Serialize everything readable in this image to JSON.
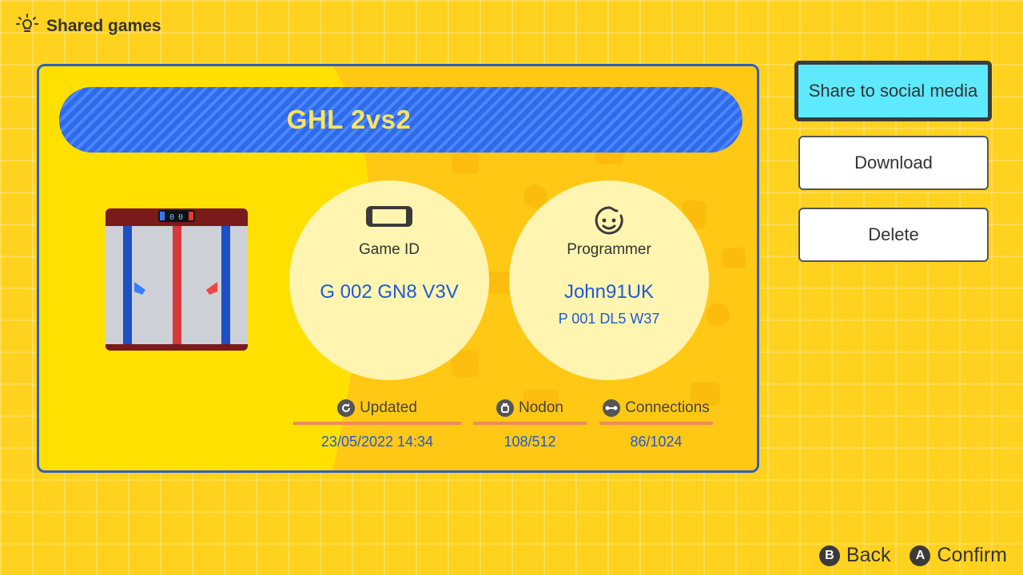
{
  "header": {
    "title": "Shared games",
    "icon": "lightbulb-icon"
  },
  "game": {
    "title": "GHL 2vs2",
    "thumbnail": {
      "score_left": "0",
      "score_right": "0"
    },
    "game_id": {
      "label": "Game ID",
      "value": "G 002 GN8 V3V",
      "icon": "console-icon"
    },
    "programmer": {
      "label": "Programmer",
      "name": "John91UK",
      "id": "P 001 DL5 W37",
      "icon": "face-icon"
    },
    "stats": {
      "updated": {
        "label": "Updated",
        "value": "23/05/2022 14:34",
        "icon": "refresh-icon"
      },
      "nodon": {
        "label": "Nodon",
        "value": "108/512",
        "icon": "nodon-icon"
      },
      "connections": {
        "label": "Connections",
        "value": "86/1024",
        "icon": "connection-icon"
      }
    }
  },
  "actions": {
    "share": "Share to social media",
    "download": "Download",
    "delete": "Delete"
  },
  "footer": {
    "back": {
      "key": "B",
      "label": "Back"
    },
    "confirm": {
      "key": "A",
      "label": "Confirm"
    }
  },
  "colors": {
    "background": "#ffd21f",
    "card": "#ffe000",
    "card_border": "#2d5fc0",
    "banner": "#2f6ae8",
    "title_text": "#fde45f",
    "value_text": "#1f59d9",
    "selected_button": "#5ee9ff",
    "stat_underline": "#f28a5a"
  }
}
